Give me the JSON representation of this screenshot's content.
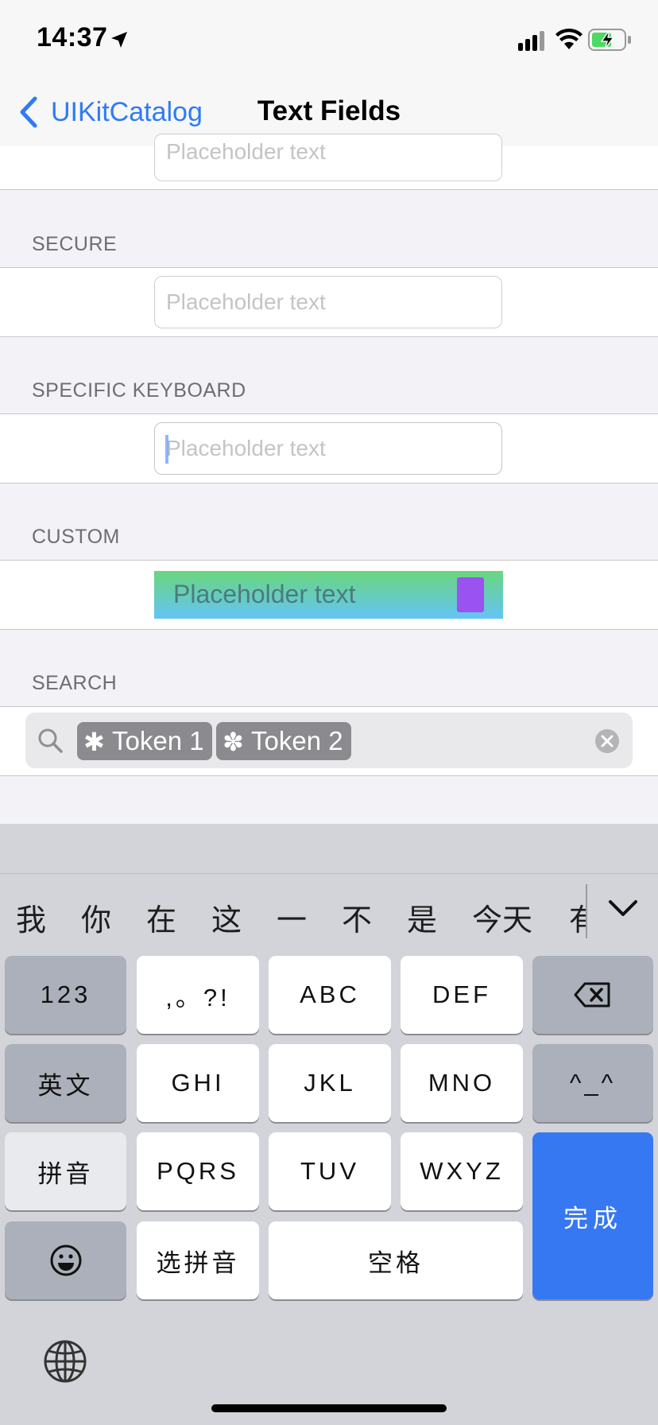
{
  "status_bar": {
    "time": "14:37"
  },
  "nav": {
    "back_label": "UIKitCatalog",
    "title": "Text Fields"
  },
  "sections": {
    "partial_field_placeholder": "Placeholder text",
    "secure": {
      "header": "SECURE",
      "placeholder": "Placeholder text"
    },
    "specific_keyboard": {
      "header": "SPECIFIC KEYBOARD",
      "placeholder": "Placeholder text"
    },
    "custom": {
      "header": "CUSTOM",
      "placeholder": "Placeholder text"
    },
    "search": {
      "header": "SEARCH",
      "tokens": [
        "Token 1",
        "Token 2"
      ]
    }
  },
  "keyboard": {
    "candidates": [
      "我",
      "你",
      "在",
      "这",
      "一",
      "不",
      "是",
      "今天",
      "有"
    ],
    "keys": {
      "numbers": "123",
      "punct": ",。?!",
      "abc": "ABC",
      "def": "DEF",
      "english": "英文",
      "ghi": "GHI",
      "jkl": "JKL",
      "mno": "MNO",
      "emoticon": "^_^",
      "pinyin": "拼音",
      "pqrs": "PQRS",
      "tuv": "TUV",
      "wxyz": "WXYZ",
      "done": "完成",
      "select_pinyin": "选拼音",
      "space": "空格"
    }
  },
  "colors": {
    "accent": "#2f7bf5",
    "done_key": "#3678f2",
    "token_bg": "#8b8b8f",
    "custom_swatch": "#9a52f0"
  },
  "icons": [
    "location-arrow-icon",
    "cellular-signal-icon",
    "wifi-icon",
    "battery-charging-icon",
    "back-chevron-icon",
    "search-icon",
    "asterisk-icon",
    "flower-icon",
    "clear-icon",
    "collapse-chevron-icon",
    "backspace-icon",
    "emoji-icon",
    "globe-icon"
  ]
}
